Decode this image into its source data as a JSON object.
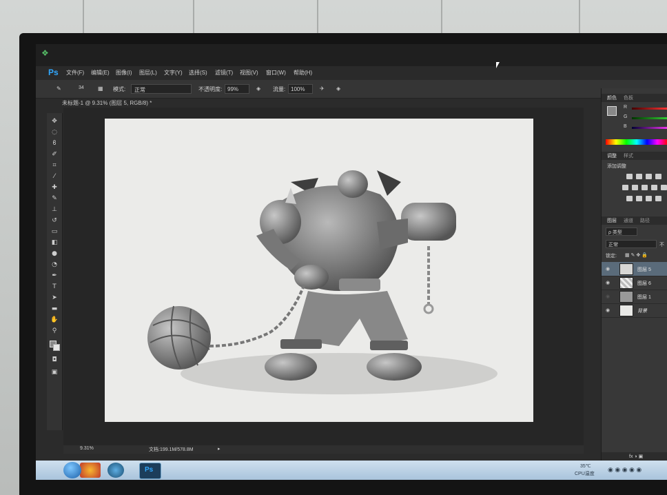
{
  "menu": {
    "items": [
      "文件(F)",
      "编辑(E)",
      "图像(I)",
      "图层(L)",
      "文字(Y)",
      "选择(S)",
      "滤镜(T)",
      "视图(V)",
      "窗口(W)",
      "帮助(H)"
    ],
    "ps_logo": "Ps"
  },
  "options": {
    "brush_size": "34",
    "mode_label": "模式:",
    "mode_value": "正常",
    "opacity_label": "不透明度:",
    "opacity_value": "99%",
    "flow_label": "流量:",
    "flow_value": "100%"
  },
  "document": {
    "tab_title": "未标题-1 @ 9.31% (图层 5, RGB/8) *"
  },
  "status": {
    "zoom": "9.31%",
    "doc_info": "文档:199.1M/578.8M"
  },
  "panels": {
    "color_tab": "颜色",
    "swatch_tab": "色板",
    "rgb_labels": [
      "R",
      "G",
      "B"
    ],
    "adjust_tab": "调整",
    "style_tab": "样式",
    "adjust_title": "添加调整",
    "layers_tab": "图层",
    "channels_tab": "通道",
    "paths_tab": "路径",
    "kind_label": "ρ 类型",
    "blend_mode": "正常",
    "blend_extra": "不",
    "lock_label": "锁定:",
    "layers": [
      {
        "name": "图层 5"
      },
      {
        "name": "图层 6"
      },
      {
        "name": "图层 1"
      },
      {
        "name": "背景"
      }
    ]
  },
  "taskbar": {
    "ps_label": "Ps",
    "temp": "35℃",
    "cpu_label": "CPU温度"
  },
  "colors": {
    "ps_blue": "#31a8ff",
    "canvas": "#ebebe9",
    "ui_dark": "#2b2b2b"
  }
}
